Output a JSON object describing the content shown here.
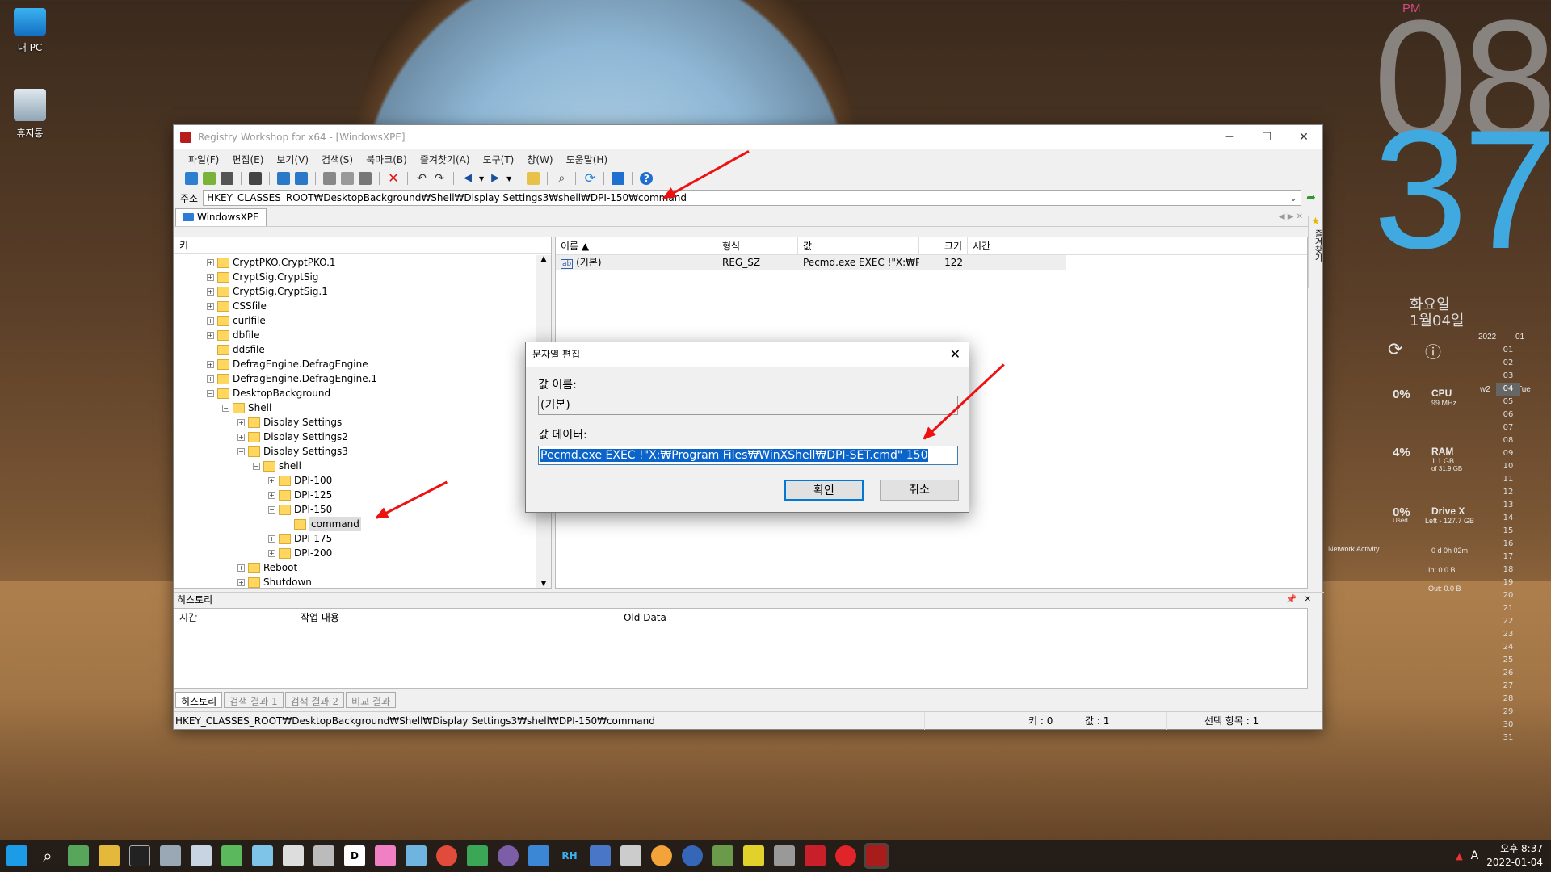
{
  "desktop": {
    "icons": [
      {
        "label": "내 PC",
        "icon": "monitor-icon"
      },
      {
        "label": "휴지통",
        "icon": "recycle-bin-icon"
      }
    ]
  },
  "clock": {
    "ampm": "PM",
    "hour": "08",
    "minute": "37",
    "weekday": "화요일",
    "date": "1월04일"
  },
  "widget": {
    "cpu": {
      "pct": "0%",
      "label": "CPU",
      "sub": "99 MHz"
    },
    "ram": {
      "pct": "4%",
      "label": "RAM",
      "sub": "1.1 GB",
      "sub2": "of 31.9 GB"
    },
    "drive": {
      "pct": "0%",
      "pct_sub": "Used",
      "label": "Drive X",
      "sub": "Left - 127.7 GB"
    },
    "net": {
      "title": "Network Activity",
      "uptime": "0 d 0h 02m",
      "in": "In: 0.0 B",
      "out": "Out: 0.0 B"
    },
    "calendar": {
      "year": "2022",
      "month": "01",
      "week": "w2",
      "today_label": "Tue",
      "days": [
        "01",
        "02",
        "03",
        "04",
        "05",
        "06",
        "07",
        "08",
        "09",
        "10",
        "11",
        "12",
        "13",
        "14",
        "15",
        "16",
        "17",
        "18",
        "19",
        "20",
        "21",
        "22",
        "23",
        "24",
        "25",
        "26",
        "27",
        "28",
        "29",
        "30",
        "31"
      ]
    }
  },
  "window": {
    "title": "Registry Workshop for x64 - [WindowsXPE]",
    "menu": [
      "파일(F)",
      "편집(E)",
      "보기(V)",
      "검색(S)",
      "북마크(B)",
      "즐겨찾기(A)",
      "도구(T)",
      "창(W)",
      "도움말(H)"
    ],
    "address_label": "주소",
    "address": "HKEY_CLASSES_ROOT₩DesktopBackground₩Shell₩Display Settings3₩shell₩DPI-150₩command",
    "tab": "WindowsXPE",
    "tree_header": "키",
    "tree": [
      {
        "label": "CryptPKO.CryptPKO.1",
        "level": 0,
        "exp": "+"
      },
      {
        "label": "CryptSig.CryptSig",
        "level": 0,
        "exp": "+"
      },
      {
        "label": "CryptSig.CryptSig.1",
        "level": 0,
        "exp": "+"
      },
      {
        "label": "CSSfile",
        "level": 0,
        "exp": "+"
      },
      {
        "label": "curlfile",
        "level": 0,
        "exp": "+"
      },
      {
        "label": "dbfile",
        "level": 0,
        "exp": "+"
      },
      {
        "label": "ddsfile",
        "level": 0,
        "exp": ""
      },
      {
        "label": "DefragEngine.DefragEngine",
        "level": 0,
        "exp": "+"
      },
      {
        "label": "DefragEngine.DefragEngine.1",
        "level": 0,
        "exp": "+"
      },
      {
        "label": "DesktopBackground",
        "level": 0,
        "exp": "-"
      },
      {
        "label": "Shell",
        "level": 1,
        "exp": "-"
      },
      {
        "label": "Display Settings",
        "level": 2,
        "exp": "+"
      },
      {
        "label": "Display Settings2",
        "level": 2,
        "exp": "+"
      },
      {
        "label": "Display Settings3",
        "level": 2,
        "exp": "-"
      },
      {
        "label": "shell",
        "level": 3,
        "exp": "-"
      },
      {
        "label": "DPI-100",
        "level": 4,
        "exp": "+"
      },
      {
        "label": "DPI-125",
        "level": 4,
        "exp": "+"
      },
      {
        "label": "DPI-150",
        "level": 4,
        "exp": "-"
      },
      {
        "label": "command",
        "level": 5,
        "exp": "",
        "selected": true
      },
      {
        "label": "DPI-175",
        "level": 4,
        "exp": "+"
      },
      {
        "label": "DPI-200",
        "level": 4,
        "exp": "+"
      },
      {
        "label": "Reboot",
        "level": 2,
        "exp": "+"
      },
      {
        "label": "Shutdown",
        "level": 2,
        "exp": "+"
      }
    ],
    "columns": [
      "이름",
      "형식",
      "값",
      "크기",
      "시간"
    ],
    "rows": [
      {
        "name": "(기본)",
        "type": "REG_SZ",
        "value": "Pecmd.exe EXEC !\"X:₩P...",
        "size": "122",
        "time": ""
      }
    ],
    "favorites_label": "즐겨찾기",
    "history_title": "히스토리",
    "history_columns": [
      "시간",
      "작업 내용",
      "Old Data"
    ],
    "bottom_tabs": [
      "히스토리",
      "검색 결과 1",
      "검색 결과 2",
      "비교 결과"
    ],
    "status": {
      "path": "HKEY_CLASSES_ROOT₩DesktopBackground₩Shell₩Display Settings3₩shell₩DPI-150₩command",
      "keys": "키 : 0",
      "values": "값 : 1",
      "selected": "선택 항목 : 1"
    }
  },
  "dialog": {
    "title": "문자열 편집",
    "name_label": "값 이름:",
    "name_value": "(기본)",
    "data_label": "값 데이터:",
    "data_value": "Pecmd.exe EXEC !\"X:₩Program Files₩WinXShell₩DPI-SET.cmd\" 150",
    "ok": "확인",
    "cancel": "취소"
  },
  "taskbar": {
    "time": "오후 8:37",
    "date": "2022-01-04",
    "ime": "A"
  }
}
